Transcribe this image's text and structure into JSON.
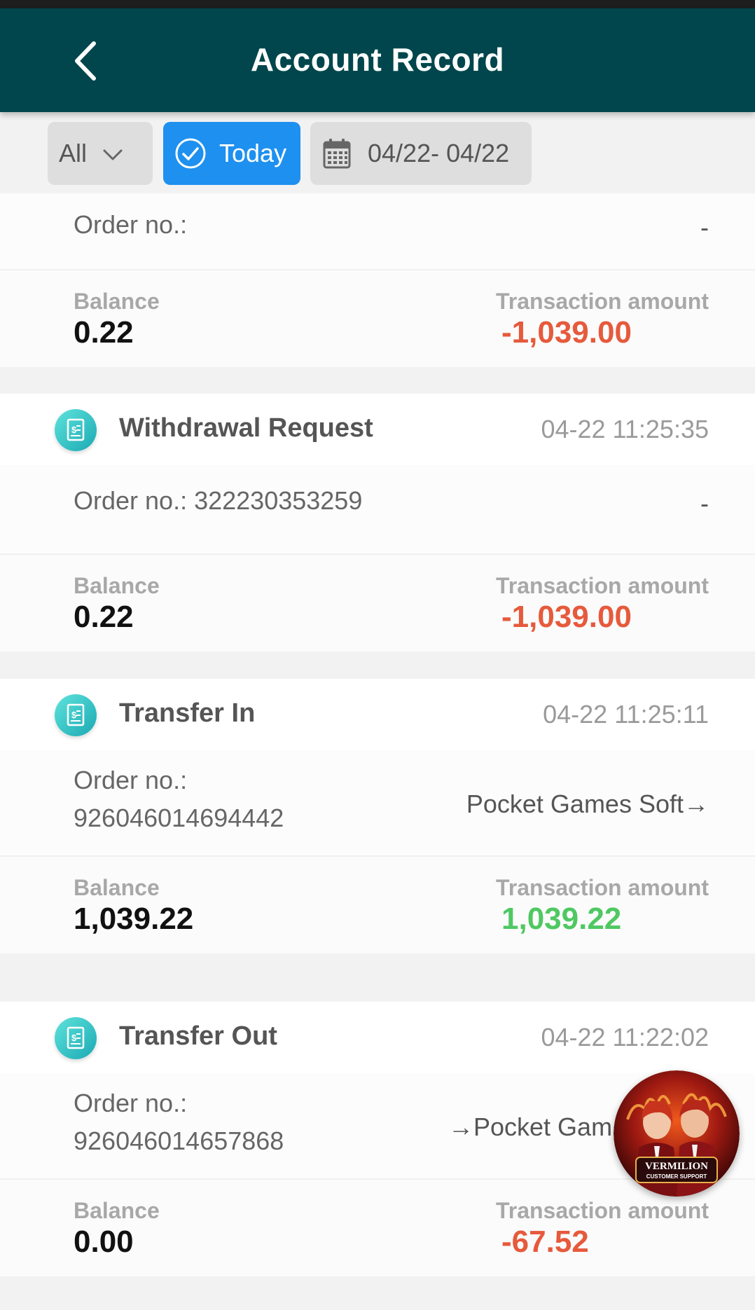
{
  "header": {
    "title": "Account Record"
  },
  "filters": {
    "type_selected": "All",
    "today_label": "Today",
    "date_range": "04/22- 04/22"
  },
  "records": [
    {
      "order_label": "Order no.:",
      "order_right": "-",
      "balance_label": "Balance",
      "balance": "0.22",
      "amount_label": "Transaction amount",
      "amount": "-1,039.00"
    },
    {
      "type": "Withdrawal Request",
      "time": "04-22 11:25:35",
      "order_label": "Order no.:",
      "order_no": "322230353259",
      "order_right": "-",
      "balance_label": "Balance",
      "balance": "0.22",
      "amount_label": "Transaction amount",
      "amount": "-1,039.00"
    },
    {
      "type": "Transfer In",
      "time": "04-22 11:25:11",
      "order_label": "Order no.:",
      "order_no": "926046014694442",
      "order_right": "Pocket Games Soft→",
      "balance_label": "Balance",
      "balance": "1,039.22",
      "amount_label": "Transaction amount",
      "amount": "1,039.22"
    },
    {
      "type": "Transfer Out",
      "time": "04-22 11:22:02",
      "order_label": "Order no.:",
      "order_no": "926046014657868",
      "order_right": "→Pocket Gam",
      "balance_label": "Balance",
      "balance": "0.00",
      "amount_label": "Transaction amount",
      "amount": "-67.52"
    }
  ],
  "support_badge": {
    "brand": "VERMILION",
    "caption": "CUSTOMER SUPPORT"
  },
  "colors": {
    "header_bg": "#00464c",
    "today_chip": "#1e90f0",
    "negative": "#e65a3c",
    "positive": "#4fc862",
    "record_icon": "#1aa9b3"
  }
}
